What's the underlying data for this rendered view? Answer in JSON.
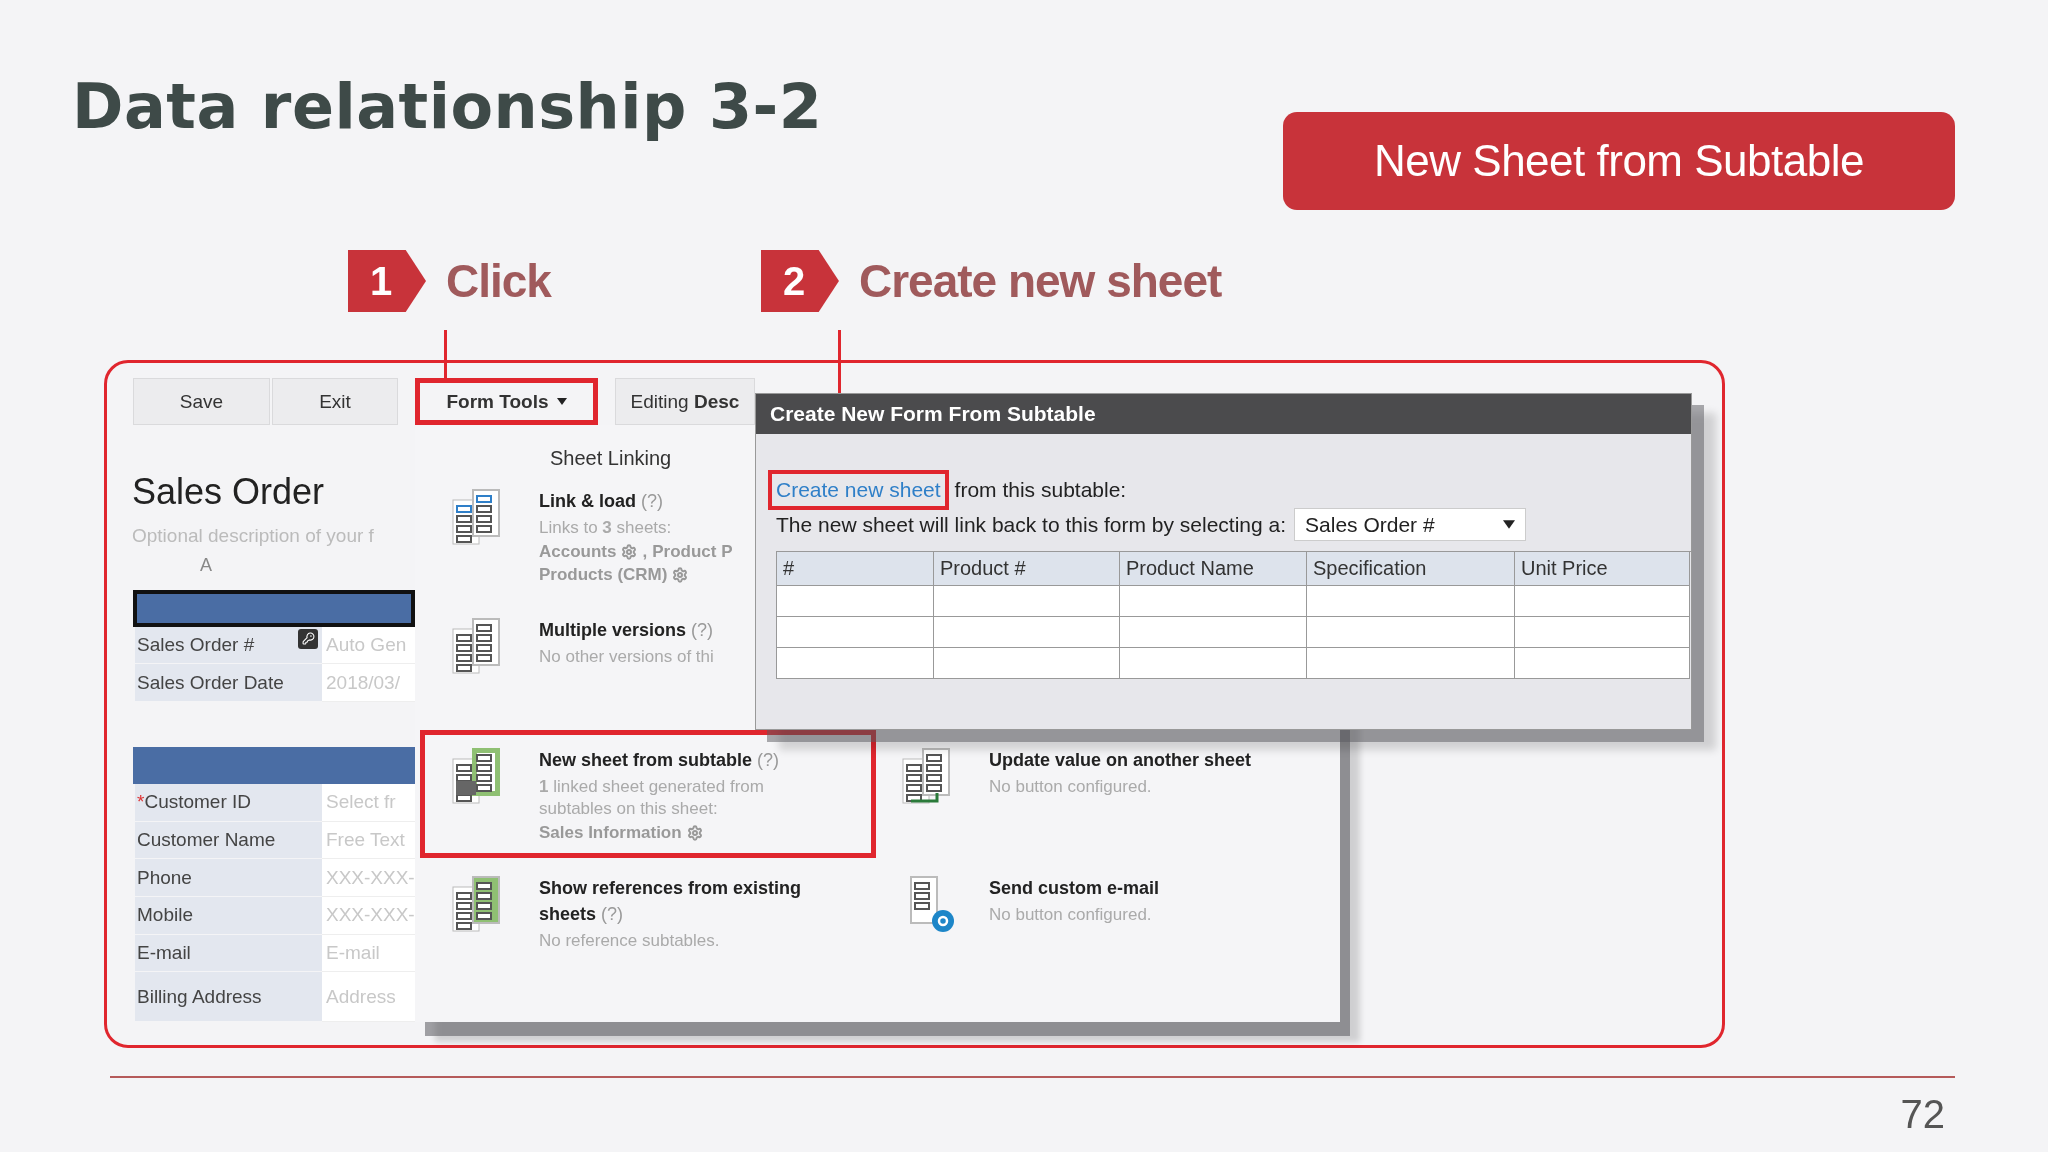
{
  "slide": {
    "title": "Data relationship 3-2",
    "badge": "New Sheet from Subtable",
    "page_number": "72"
  },
  "steps": [
    {
      "number": "1",
      "label": "Click"
    },
    {
      "number": "2",
      "label": "Create new sheet"
    }
  ],
  "toolbar": [
    {
      "label": "Save",
      "highlighted": false,
      "dropdown": false
    },
    {
      "label": "Exit",
      "highlighted": false,
      "dropdown": false
    },
    {
      "label": "Form Tools",
      "highlighted": true,
      "dropdown": true
    },
    {
      "label": "Editing **Desc**",
      "highlighted": false,
      "dropdown": false
    }
  ],
  "form": {
    "title": "Sales Order",
    "description": "Optional description of your f",
    "column_label": "A",
    "sections": [
      {
        "selected": true,
        "fields": [
          {
            "label": "Sales Order #",
            "placeholder": "Auto Gen",
            "lookup": true
          },
          {
            "label": "Sales Order Date",
            "placeholder": "2018/03/",
            "lookup": false
          }
        ]
      },
      {
        "selected": false,
        "fields": [
          {
            "marker": "*",
            "label": "Customer ID",
            "placeholder": "Select fr",
            "lookup": false
          },
          {
            "label": "Customer Name",
            "placeholder": "Free Text",
            "lookup": false
          },
          {
            "label": "Phone",
            "placeholder": "XXX-XXX-",
            "lookup": false
          },
          {
            "label": "Mobile",
            "placeholder": "XXX-XXX-",
            "lookup": false
          },
          {
            "label": "E-mail",
            "placeholder": "E-mail",
            "lookup": false
          },
          {
            "label": "Billing Address",
            "placeholder": "Address",
            "lookup": false
          }
        ]
      }
    ]
  },
  "menu": {
    "heading": "Sheet Linking",
    "rows": [
      [
        {
          "title": "Link & load",
          "help": "(?)",
          "highlighted": false,
          "description": "Links to **3** sheets:",
          "refs": [
            [
              {
                "name": "Accounts",
                "gear": true,
                "after": ","
              },
              {
                "name": "Product P",
                "gear": false
              }
            ],
            [
              {
                "name": "Products (CRM)",
                "gear": true
              }
            ]
          ]
        }
      ],
      [
        {
          "title": "Multiple versions",
          "help": "(?)",
          "highlighted": false,
          "description": "No other versions of thi"
        }
      ],
      [
        {
          "title": "New sheet from subtable",
          "help": "(?)",
          "highlighted": true,
          "description": "**1** linked sheet generated from subtables on this sheet:",
          "refs": [
            [
              {
                "name": "Sales Information",
                "gear": true
              }
            ]
          ]
        },
        {
          "title": "Update value on another sheet",
          "highlighted": false,
          "description": "No button configured."
        }
      ],
      [
        {
          "title": "Show references from existing sheets",
          "help": "(?)",
          "highlighted": false,
          "description": "No reference subtables."
        },
        {
          "title": "Send custom e-mail",
          "highlighted": false,
          "description": "No button configured."
        }
      ]
    ]
  },
  "dialog": {
    "title": "Create New Form From Subtable",
    "link": "Create new sheet",
    "link_highlighted": true,
    "link_suffix": "from this subtable:",
    "prompt": "The new sheet will link back to this form by selecting a:",
    "select": {
      "value": "Sales Order #"
    },
    "table": {
      "columns": [
        "#",
        "Product #",
        "Product Name",
        "Specification",
        "Unit Price"
      ]
    }
  }
}
